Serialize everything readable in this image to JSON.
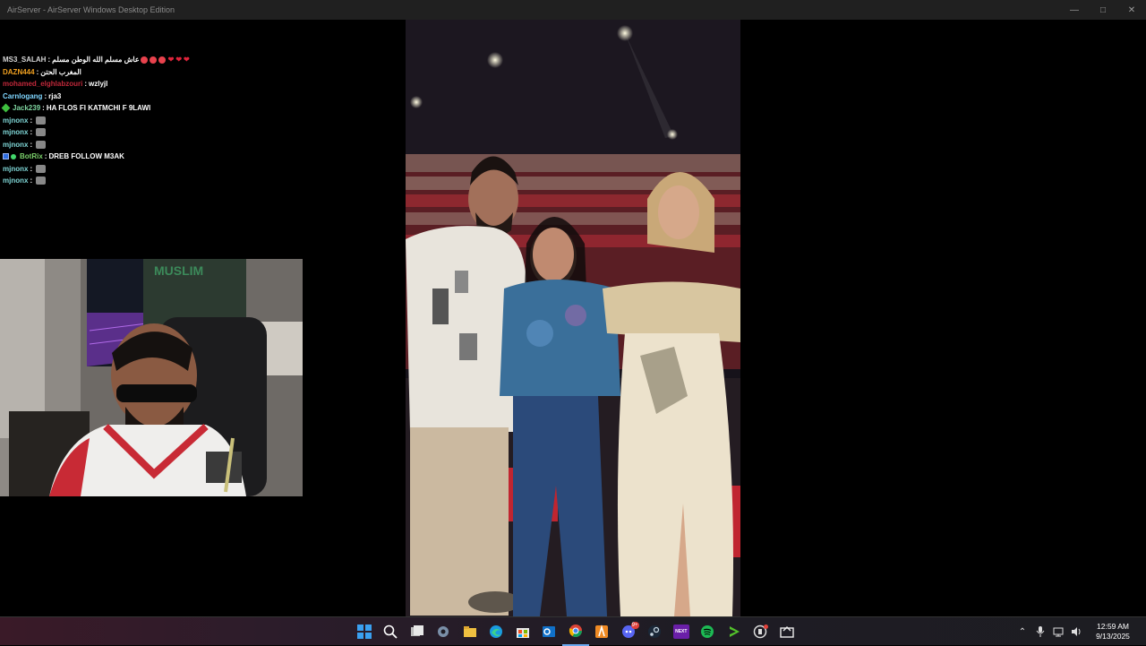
{
  "window": {
    "title": "AirServer - AirServer Windows Desktop Edition",
    "minimize_icon": "minimize-icon",
    "maximize_icon": "maximize-icon",
    "close_icon": "close-icon"
  },
  "chat": {
    "messages": [
      {
        "user": "MS3_SALAH",
        "user_color": "#d6d6d6",
        "text": "عاش مسلم الله الوطن مسلم",
        "emotes": [
          "face",
          "face",
          "face",
          "heart",
          "heart",
          "heart"
        ]
      },
      {
        "user": "DAZN444",
        "user_color": "#f0a020",
        "text": "المغرب الحتن"
      },
      {
        "user": "mohamed_elghlabzouri",
        "user_color": "#c0283a",
        "text": "wzlyjl"
      },
      {
        "user": "Carnlogang",
        "user_color": "#7fd6ff",
        "text": "rja3"
      },
      {
        "user": "Jack239",
        "user_color": "#7fd6a0",
        "badge": "green",
        "text": "HA FLOS FI KATMCHI F 9LAWI"
      },
      {
        "user": "mjnonx",
        "user_color": "#7fd6d6",
        "text": "",
        "emotes": [
          "car"
        ]
      },
      {
        "user": "mjnonx",
        "user_color": "#7fd6d6",
        "text": "",
        "emotes": [
          "car"
        ]
      },
      {
        "user": "mjnonx",
        "user_color": "#7fd6d6",
        "text": "",
        "emotes": [
          "car"
        ]
      },
      {
        "user": "BotRix",
        "user_color": "#7bd16b",
        "badge": "bot",
        "text": "DREB FOLLOW M3AK"
      },
      {
        "user": "mjnonx",
        "user_color": "#7fd6d6",
        "text": "",
        "emotes": [
          "car"
        ]
      },
      {
        "user": "mjnonx",
        "user_color": "#7fd6d6",
        "text": "",
        "emotes": [
          "car"
        ]
      }
    ]
  },
  "webcam": {
    "sign_text": "MUSLIM"
  },
  "taskbar": {
    "icons": [
      "windows-start-icon",
      "search-icon",
      "task-view-icon",
      "settings-icon",
      "file-explorer-icon",
      "edge-icon",
      "store-icon",
      "outlook-icon",
      "chrome-icon",
      "app-orange-icon",
      "discord-icon",
      "steam-icon",
      "kick-next-icon",
      "spotify-icon",
      "media-player-icon",
      "game-bar-icon",
      "monitor-app-icon"
    ],
    "discord_badge": "9+",
    "next_label": "NEXT"
  },
  "tray": {
    "time": "12:59 AM",
    "date": "9/13/2025",
    "icons": [
      "chevron-up-icon",
      "microphone-icon",
      "network-icon",
      "volume-icon"
    ]
  }
}
